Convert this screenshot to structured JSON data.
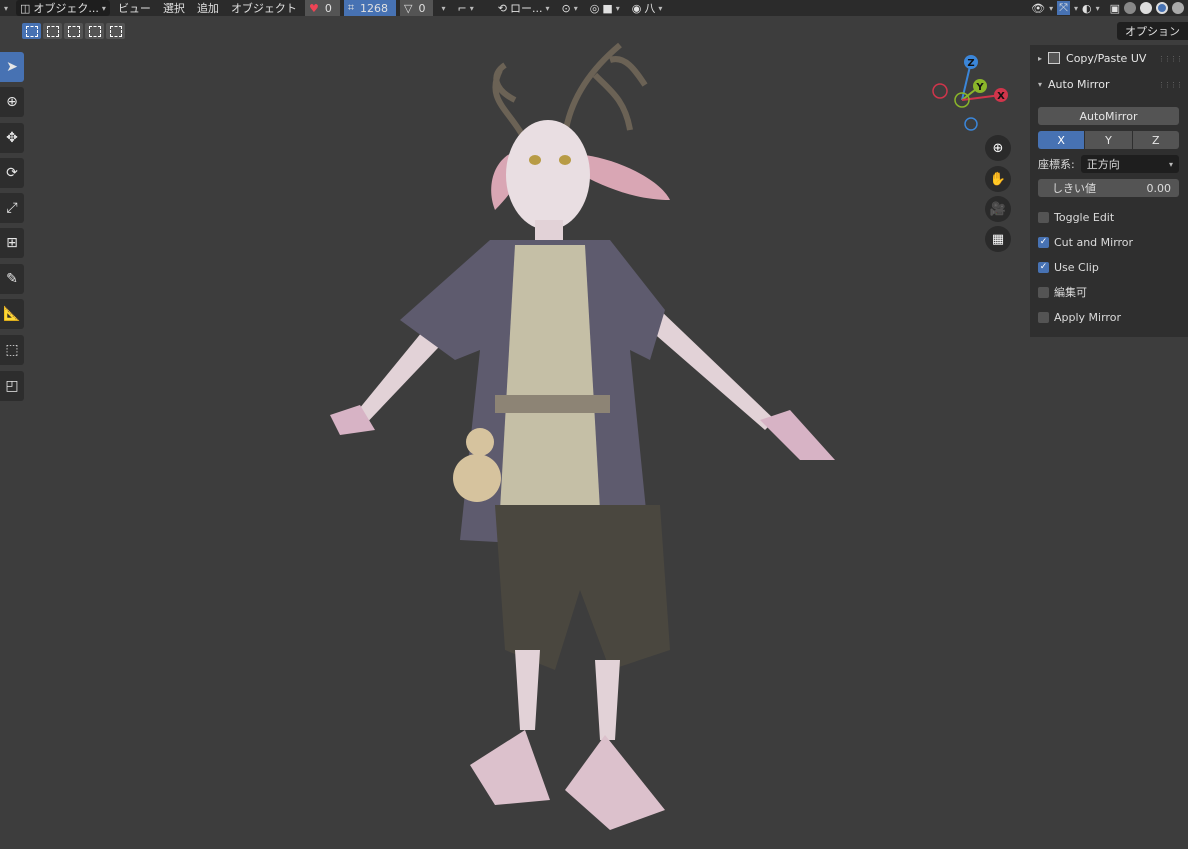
{
  "header": {
    "mode_label": "オブジェク...",
    "menus": [
      "ビュー",
      "選択",
      "追加",
      "オブジェクト"
    ],
    "stats": [
      "0",
      "1268",
      "0"
    ],
    "pivot_label": "ロー..."
  },
  "options_label": "オプション",
  "panel": {
    "copy_paste_uv": "Copy/Paste UV",
    "auto_mirror": "Auto Mirror",
    "automirror_button": "AutoMirror",
    "axes": [
      "X",
      "Y",
      "Z"
    ],
    "orientation_label": "座標系:",
    "orientation_value": "正方向",
    "threshold_label": "しきい値",
    "threshold_value": "0.00",
    "checks": [
      {
        "label": "Toggle Edit",
        "checked": false
      },
      {
        "label": "Cut and Mirror",
        "checked": true
      },
      {
        "label": "Use Clip",
        "checked": true
      },
      {
        "label": "編集可",
        "checked": false
      },
      {
        "label": "Apply Mirror",
        "checked": false
      }
    ]
  },
  "gizmo": {
    "z": "Z",
    "y": "Y",
    "x": "X"
  },
  "colors": {
    "accent": "#4772b3",
    "x_axis": "#d0354b",
    "y_axis": "#8bb62a",
    "z_axis": "#3b86d9"
  }
}
